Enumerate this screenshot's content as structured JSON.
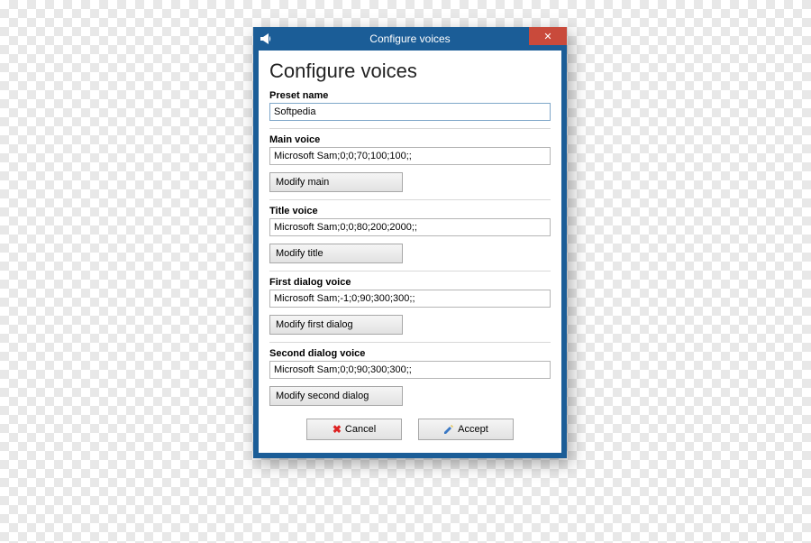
{
  "titlebar": {
    "title": "Configure voices",
    "close_symbol": "✕"
  },
  "heading": "Configure voices",
  "preset": {
    "label": "Preset name",
    "value": "Softpedia"
  },
  "main_voice": {
    "label": "Main voice",
    "value": "Microsoft Sam;0;0;70;100;100;;",
    "modify_label": "Modify main"
  },
  "title_voice": {
    "label": "Title voice",
    "value": "Microsoft Sam;0;0;80;200;2000;;",
    "modify_label": "Modify title"
  },
  "first_dialog": {
    "label": "First dialog  voice",
    "value": "Microsoft Sam;-1;0;90;300;300;;",
    "modify_label": "Modify first dialog"
  },
  "second_dialog": {
    "label": "Second dialog voice",
    "value": "Microsoft Sam;0;0;90;300;300;;",
    "modify_label": "Modify second dialog"
  },
  "actions": {
    "cancel": "Cancel",
    "accept": "Accept"
  }
}
